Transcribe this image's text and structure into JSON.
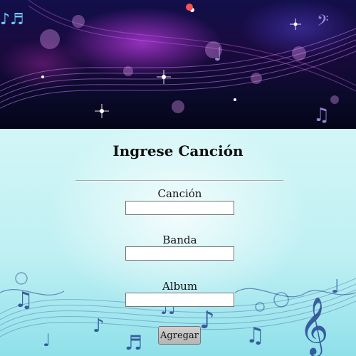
{
  "form": {
    "title": "Ingrese Canción",
    "fields": [
      {
        "label": "Canción",
        "value": "",
        "placeholder": ""
      },
      {
        "label": "Banda",
        "value": "",
        "placeholder": ""
      },
      {
        "label": "Album",
        "value": "",
        "placeholder": ""
      }
    ],
    "submit_label": "Agregar"
  },
  "theme": {
    "banner": "#120f4a",
    "accent_purple": "#b43ce6",
    "background": "#bff0f3",
    "notes": "#1e3a8a"
  },
  "icons": [
    "music-notes-banner",
    "music-staff-decoration",
    "treble-clef-icon"
  ]
}
